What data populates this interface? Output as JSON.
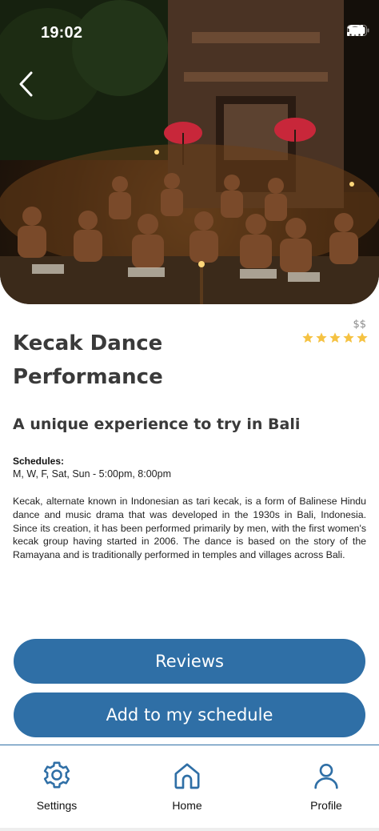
{
  "status_bar": {
    "time": "19:02"
  },
  "event": {
    "title": "Kecak Dance Performance",
    "price_level": "$$",
    "rating": 5,
    "rating_max": 5,
    "subtitle": "A unique experience to try in Bali",
    "schedules_label": "Schedules:",
    "schedules_value": "M, W, F, Sat, Sun - 5:00pm, 8:00pm",
    "description": "Kecak, alternate known in Indonesian as tari kecak, is a form of Balinese Hindu dance and music drama that was developed in the 1930s in Bali, Indonesia. Since its creation, it has been performed primarily by men, with the first women's kecak group having started in 2006. The dance is based on the story of the Ramayana and is traditionally performed in temples and villages across Bali."
  },
  "actions": {
    "reviews_label": "Reviews",
    "add_schedule_label": "Add to my schedule"
  },
  "bottom_nav": {
    "items": [
      {
        "label": "Settings",
        "icon": "gear-icon"
      },
      {
        "label": "Home",
        "icon": "home-icon"
      },
      {
        "label": "Profile",
        "icon": "user-icon"
      }
    ]
  },
  "colors": {
    "accent": "#2f6fa6",
    "star": "#f5c242",
    "text_dark": "#3a3a3a"
  }
}
